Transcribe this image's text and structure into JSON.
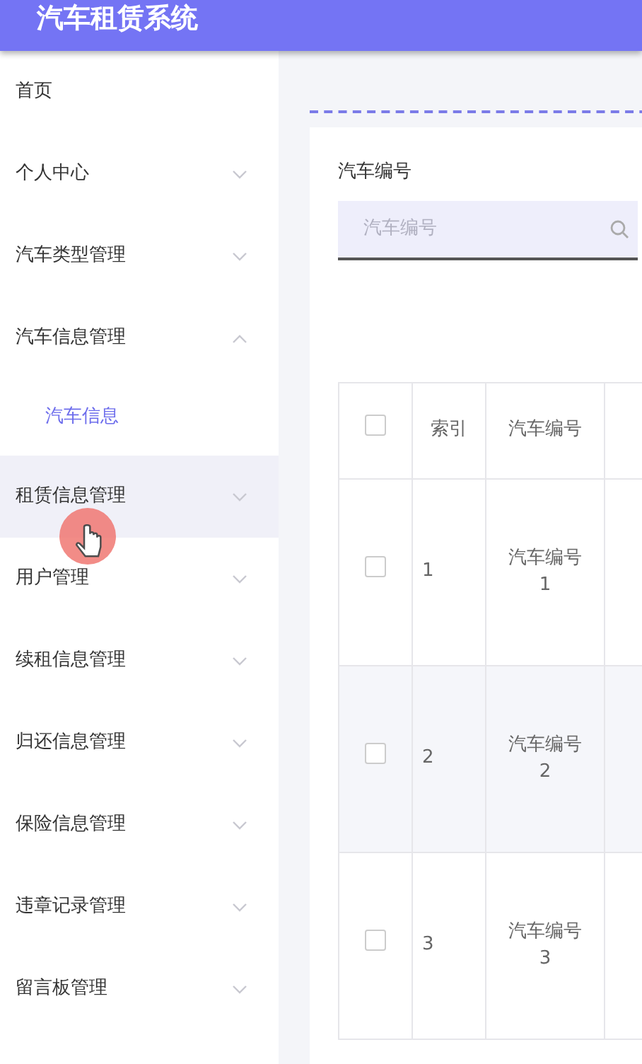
{
  "app": {
    "title": "汽车租赁系统"
  },
  "sidebar": {
    "items": [
      {
        "kind": "link",
        "label": "首页",
        "hovered": false
      },
      {
        "kind": "group",
        "label": "个人中心",
        "expanded": false,
        "hovered": false
      },
      {
        "kind": "group",
        "label": "汽车类型管理",
        "expanded": false,
        "hovered": false
      },
      {
        "kind": "group",
        "label": "汽车信息管理",
        "expanded": true,
        "hovered": false,
        "children": [
          {
            "label": "汽车信息",
            "selected": true
          }
        ]
      },
      {
        "kind": "group",
        "label": "租赁信息管理",
        "expanded": false,
        "hovered": true
      },
      {
        "kind": "group",
        "label": "用户管理",
        "expanded": false,
        "hovered": false
      },
      {
        "kind": "group",
        "label": "续租信息管理",
        "expanded": false,
        "hovered": false
      },
      {
        "kind": "group",
        "label": "归还信息管理",
        "expanded": false,
        "hovered": false
      },
      {
        "kind": "group",
        "label": "保险信息管理",
        "expanded": false,
        "hovered": false
      },
      {
        "kind": "group",
        "label": "违章记录管理",
        "expanded": false,
        "hovered": false
      },
      {
        "kind": "group",
        "label": "留言板管理",
        "expanded": false,
        "hovered": false
      }
    ]
  },
  "search": {
    "label": "汽车编号",
    "placeholder": "汽车编号"
  },
  "table": {
    "columns": [
      {
        "kind": "checkbox",
        "checked": false
      },
      {
        "kind": "text",
        "label": "索引"
      },
      {
        "kind": "text",
        "label": "汽车编号"
      }
    ],
    "rows": [
      {
        "checked": false,
        "cells": [
          "",
          "1",
          "汽车编号 1"
        ]
      },
      {
        "checked": false,
        "cells": [
          "",
          "2",
          "汽车编号 2"
        ]
      },
      {
        "checked": false,
        "cells": [
          "",
          "3",
          "汽车编号 3"
        ]
      }
    ]
  }
}
